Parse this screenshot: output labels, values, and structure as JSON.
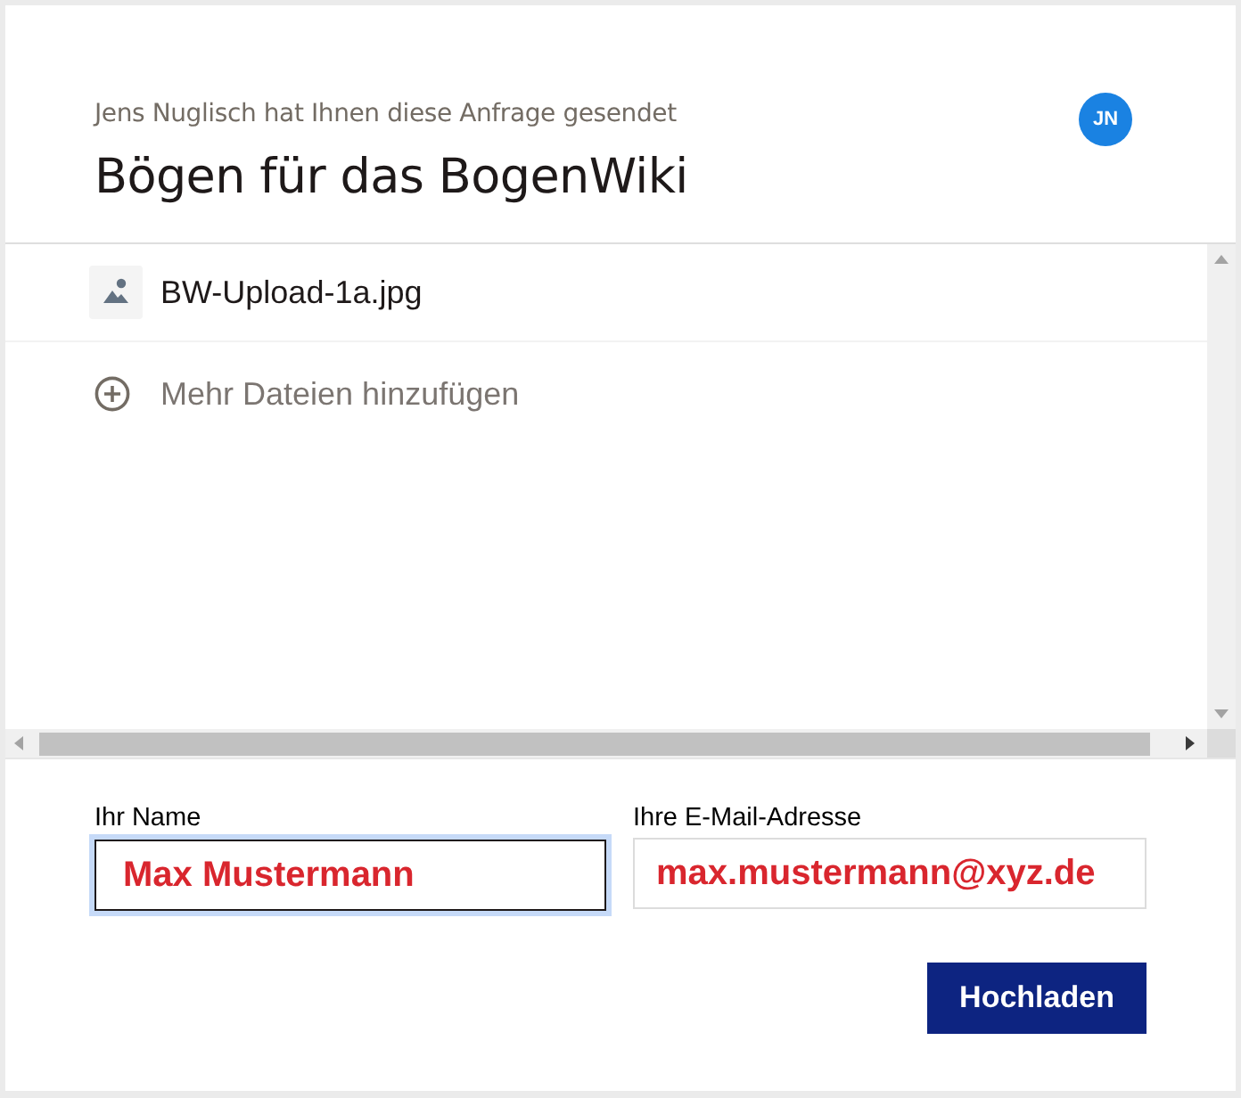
{
  "header": {
    "sender_line": "Jens Nuglisch hat Ihnen diese Anfrage gesendet",
    "title": "Bögen für das BogenWiki",
    "avatar_initials": "JN"
  },
  "files": [
    {
      "name": "BW-Upload-1a.jpg"
    }
  ],
  "add_more": {
    "label": "Mehr Dateien hinzufügen"
  },
  "form": {
    "fields": [
      {
        "label": "Ihr Name",
        "value": "Max Mustermann",
        "focused": true
      },
      {
        "label": "Ihre E-Mail-Adresse",
        "value": "max.mustermann@xyz.de",
        "focused": false
      }
    ],
    "submit": "Hochladen"
  }
}
